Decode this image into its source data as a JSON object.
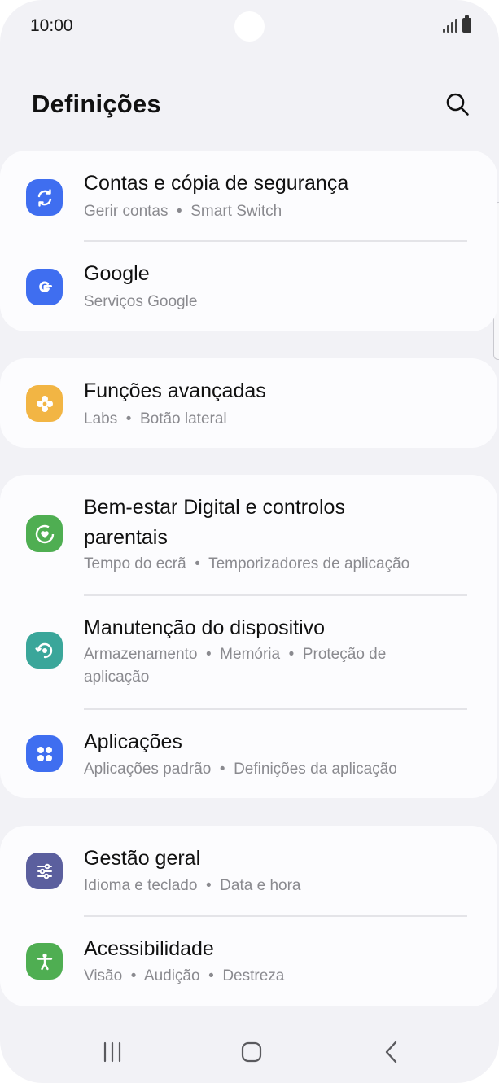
{
  "status_bar": {
    "time": "10:00"
  },
  "header": {
    "title": "Definições"
  },
  "groups": [
    {
      "items": [
        {
          "title": "Contas e cópia de segurança",
          "subtitle": "Gerir contas  •  Smart Switch",
          "icon": "sync-icon",
          "color": "#3f6ef0"
        },
        {
          "title": "Google",
          "subtitle": "Serviços Google",
          "icon": "google-icon",
          "color": "#3f6ef0"
        }
      ]
    },
    {
      "items": [
        {
          "title": "Funções avançadas",
          "subtitle": "Labs  •  Botão lateral",
          "icon": "advanced-features-icon",
          "color": "#f2b544"
        }
      ]
    },
    {
      "items": [
        {
          "title": "Bem-estar Digital e controlos parentais",
          "subtitle": "Tempo do ecrã  •  Temporizadores de aplicação",
          "icon": "digital-wellbeing-icon",
          "color": "#4fae52"
        },
        {
          "title": "Manutenção do dispositivo",
          "subtitle": "Armazenamento  •  Memória  •  Proteção de aplicação",
          "icon": "device-care-icon",
          "color": "#3aa69a"
        },
        {
          "title": "Aplicações",
          "subtitle": "Aplicações padrão  •  Definições da aplicação",
          "icon": "apps-icon",
          "color": "#3f6ef0"
        }
      ]
    },
    {
      "items": [
        {
          "title": "Gestão geral",
          "subtitle": "Idioma e teclado  •  Data e hora",
          "icon": "general-management-icon",
          "color": "#5b5f9e"
        },
        {
          "title": "Acessibilidade",
          "subtitle": "Visão  •  Audição  •  Destreza",
          "icon": "accessibility-icon",
          "color": "#4fae52"
        }
      ]
    }
  ],
  "nav": {
    "recents": "recents-icon",
    "home": "home-icon",
    "back": "back-icon"
  }
}
